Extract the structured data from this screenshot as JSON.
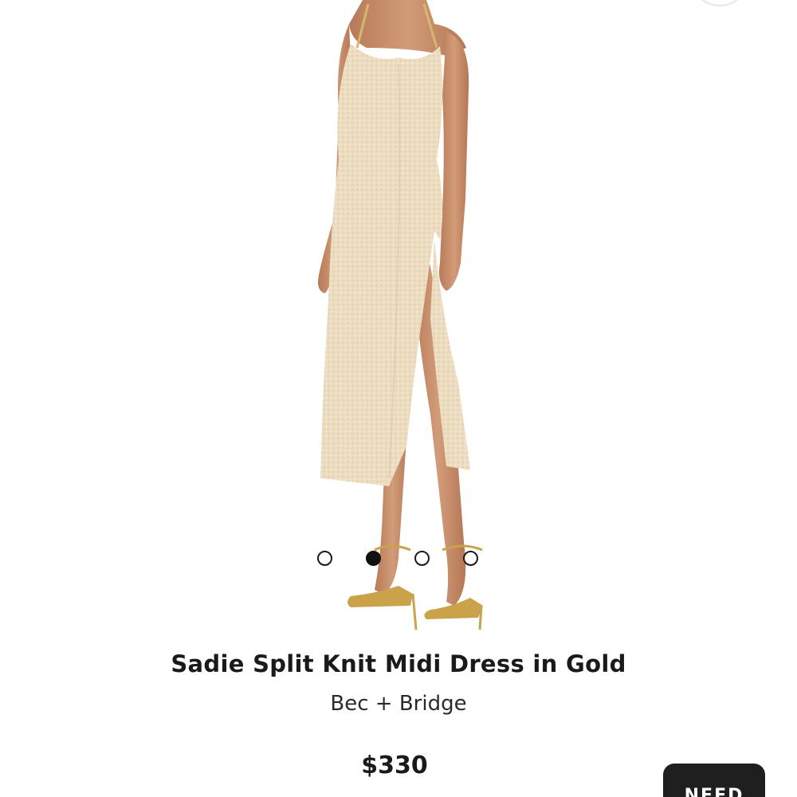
{
  "product": {
    "title": "Sadie Split Knit Midi Dress in Gold",
    "brand": "Bec + Bridge",
    "price": "$330"
  },
  "carousel": {
    "total": 4,
    "active_index": 2
  },
  "help_button": {
    "label": "NEED"
  },
  "colors": {
    "dress": "#ecdcc0",
    "dress_shadow": "#dcc6a3",
    "skin": "#c98f6b",
    "shoe_gold": "#c9a24a",
    "text": "#1a1a1a",
    "button_bg": "#1f1f1f"
  },
  "icons": [
    "corner-button"
  ]
}
